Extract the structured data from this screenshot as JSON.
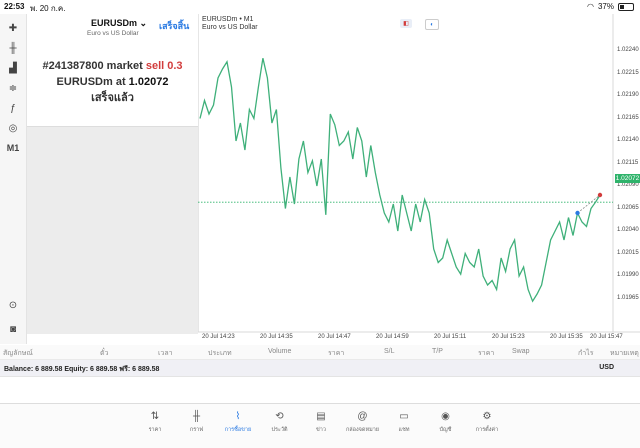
{
  "status": {
    "time": "22:53",
    "date": "พ. 20 ก.ค.",
    "battery": "37%",
    "battery_level": 0.37
  },
  "left_toolbar": {
    "items": [
      {
        "name": "crosshair-icon",
        "glyph": "✚"
      },
      {
        "name": "candlestick-icon",
        "glyph": "╫"
      },
      {
        "name": "chart-type-icon",
        "glyph": "▟"
      },
      {
        "name": "indicators-icon",
        "glyph": "≑"
      },
      {
        "name": "function-icon",
        "glyph": "ƒ"
      },
      {
        "name": "objects-icon",
        "glyph": "◎"
      },
      {
        "name": "timeframe",
        "glyph": "M1"
      }
    ],
    "bottom": [
      {
        "name": "zoom-icon",
        "glyph": "⊙"
      },
      {
        "name": "trade-panel-icon",
        "glyph": "◙"
      }
    ]
  },
  "trade_panel": {
    "symbol": "EURUSDm ⌄",
    "description": "Euro vs US Dollar",
    "done_label": "เสร็จสิ้น",
    "line1_prefix": "#241387800 market ",
    "line1_action": "sell 0.3",
    "line2_prefix": "EURUSDm at ",
    "line2_price": "1.02072",
    "line3": "เสร็จแล้ว"
  },
  "chart": {
    "title": "EURUSDm • M1",
    "subtitle": "Euro vs US Dollar",
    "current_price_label": "1.02072",
    "line_color": "#3fb07a",
    "y_ticks": [
      "1.02240",
      "1.02215",
      "1.02190",
      "1.02165",
      "1.02140",
      "1.02115",
      "1.02090",
      "1.02065",
      "1.02040",
      "1.02015",
      "1.01990",
      "1.01965"
    ],
    "x_ticks": [
      "20 Jul 14:23",
      "20 Jul 14:35",
      "20 Jul 14:47",
      "20 Jul 14:59",
      "20 Jul 15:11",
      "20 Jul 15:23",
      "20 Jul 15:35",
      "20 Jul 15:47"
    ]
  },
  "chart_data": {
    "type": "line",
    "title": "",
    "xlabel": "",
    "ylabel": "",
    "x": [
      "14:19",
      "14:20",
      "14:21",
      "14:22",
      "14:23",
      "14:24",
      "14:25",
      "14:26",
      "14:27",
      "14:28",
      "14:29",
      "14:30",
      "14:31",
      "14:32",
      "14:33",
      "14:34",
      "14:35",
      "14:36",
      "14:37",
      "14:38",
      "14:39",
      "14:40",
      "14:41",
      "14:42",
      "14:43",
      "14:44",
      "14:45",
      "14:46",
      "14:47",
      "14:48",
      "14:49",
      "14:50",
      "14:51",
      "14:52",
      "14:53",
      "14:54",
      "14:55",
      "14:56",
      "14:57",
      "14:58",
      "14:59",
      "15:00",
      "15:01",
      "15:02",
      "15:03",
      "15:04",
      "15:05",
      "15:06",
      "15:07",
      "15:08",
      "15:09",
      "15:10",
      "15:11",
      "15:12",
      "15:13",
      "15:14",
      "15:15",
      "15:16",
      "15:17",
      "15:18",
      "15:19",
      "15:20",
      "15:21",
      "15:22",
      "15:23",
      "15:24",
      "15:25",
      "15:26",
      "15:27",
      "15:28",
      "15:29",
      "15:30",
      "15:31",
      "15:32",
      "15:33",
      "15:34",
      "15:35",
      "15:36",
      "15:37",
      "15:38",
      "15:39",
      "15:40",
      "15:41",
      "15:42",
      "15:43",
      "15:44",
      "15:45",
      "15:46",
      "15:47",
      "15:48"
    ],
    "values": [
      1.02165,
      1.02185,
      1.0217,
      1.0218,
      1.0221,
      1.0222,
      1.02228,
      1.022,
      1.0214,
      1.0216,
      1.0213,
      1.02175,
      1.02165,
      1.022,
      1.02232,
      1.0221,
      1.0216,
      1.02175,
      1.0211,
      1.02065,
      1.021,
      1.0207,
      1.0212,
      1.0214,
      1.02105,
      1.02118,
      1.0209,
      1.0212,
      1.02058,
      1.0217,
      1.02158,
      1.02135,
      1.0214,
      1.0215,
      1.0212,
      1.02155,
      1.0214,
      1.021,
      1.02135,
      1.02105,
      1.0208,
      1.0206,
      1.0205,
      1.0207,
      1.0204,
      1.0208,
      1.0206,
      1.0204,
      1.0207,
      1.0205,
      1.02075,
      1.0206,
      1.0202,
      1.02005,
      1.0201,
      1.0203,
      1.02015,
      1.02,
      1.01992,
      1.02015,
      1.02005,
      1.02,
      1.0202,
      1.0199,
      1.0198,
      1.01985,
      1.01975,
      1.0201,
      1.01995,
      1.0202,
      1.0203,
      1.0199,
      1.02,
      1.01975,
      1.01962,
      1.0197,
      1.0198,
      1.02005,
      1.0203,
      1.0204,
      1.0205,
      1.0203,
      1.02055,
      1.02035,
      1.0206,
      1.0205,
      1.02045,
      1.02065,
      1.02072,
      1.0208
    ],
    "ylim": [
      1.0195,
      1.0225
    ],
    "current_price": 1.02072,
    "grid": false,
    "legend": "none"
  },
  "table_header": [
    "สัญลักษณ์",
    "ตั๋ว",
    "เวลา",
    "ประเภท",
    "Volume",
    "ราคา",
    "S/L",
    "T/P",
    "ราคา",
    "Swap",
    "กำไร",
    "หมายเหตุ"
  ],
  "balance": {
    "text": "Balance: 6 889.58 Equity: 6 889.58 ฟรี: 6 889.58",
    "currency": "USD"
  },
  "tabbar": {
    "active": 2,
    "items": [
      {
        "label": "ราคา",
        "icon": "quotes-icon",
        "glyph": "⇅"
      },
      {
        "label": "กราฟ",
        "icon": "charts-icon",
        "glyph": "╫"
      },
      {
        "label": "การซื้อขาย",
        "icon": "trade-icon",
        "glyph": "⌇"
      },
      {
        "label": "ประวัติ",
        "icon": "history-icon",
        "glyph": "⟲"
      },
      {
        "label": "ข่าว",
        "icon": "news-icon",
        "glyph": "▤"
      },
      {
        "label": "กล่องจดหมาย",
        "icon": "mailbox-icon",
        "glyph": "@"
      },
      {
        "label": "แชท",
        "icon": "chat-icon",
        "glyph": "▭"
      },
      {
        "label": "บัญชี",
        "icon": "account-icon",
        "glyph": "◉"
      },
      {
        "label": "การตั้งค่า",
        "icon": "settings-icon",
        "glyph": "⚙"
      }
    ]
  }
}
